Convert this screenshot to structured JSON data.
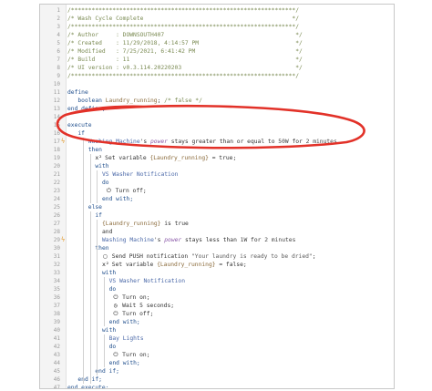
{
  "accent": {
    "annotation": "#e23128",
    "keyword": "#1f4e8c",
    "comment": "#7a8a52"
  },
  "lines": [
    {
      "n": "1",
      "t": [
        {
          "c": "cm",
          "v": "/*****************************************************************/"
        }
      ]
    },
    {
      "n": "2",
      "t": [
        {
          "c": "cm",
          "v": "/* Wash Cycle Complete                                           */"
        }
      ]
    },
    {
      "n": "3",
      "t": [
        {
          "c": "cm",
          "v": "/*****************************************************************/"
        }
      ]
    },
    {
      "n": "4",
      "t": [
        {
          "c": "cm",
          "v": "/* Author     : DOWNSOUTH407                                      */"
        }
      ]
    },
    {
      "n": "5",
      "t": [
        {
          "c": "cm",
          "v": "/* Created    : 11/29/2018, 4:14:57 PM                            */"
        }
      ]
    },
    {
      "n": "6",
      "t": [
        {
          "c": "cm",
          "v": "/* Modified   : 7/25/2021, 6:41:42 PM                             */"
        }
      ]
    },
    {
      "n": "7",
      "t": [
        {
          "c": "cm",
          "v": "/* Build      : 11                                                */"
        }
      ]
    },
    {
      "n": "8",
      "t": [
        {
          "c": "cm",
          "v": "/* UI version : v0.3.114.20220203                                 */"
        }
      ]
    },
    {
      "n": "9",
      "t": [
        {
          "c": "cm",
          "v": "/*****************************************************************/"
        }
      ]
    },
    {
      "n": "10",
      "t": []
    },
    {
      "n": "11",
      "t": [
        {
          "c": "kw",
          "v": "define"
        }
      ]
    },
    {
      "n": "12",
      "t": [
        {
          "c": "kw",
          "v": "   boolean "
        },
        {
          "c": "var",
          "v": "Laundry_running"
        },
        {
          "c": "plain",
          "v": "; "
        },
        {
          "c": "cm",
          "v": "/* false */"
        }
      ]
    },
    {
      "n": "13",
      "t": [
        {
          "c": "kw",
          "v": "end define;"
        }
      ]
    },
    {
      "n": "14",
      "t": []
    },
    {
      "n": "15",
      "t": [
        {
          "c": "kw",
          "v": "execute"
        }
      ]
    },
    {
      "n": "16",
      "t": [
        {
          "c": "kw",
          "v": "   if"
        }
      ]
    },
    {
      "n": "17",
      "warn": true,
      "t": [
        {
          "c": "dev",
          "v": "      Washing Machine"
        },
        {
          "c": "plain",
          "v": "'s "
        },
        {
          "c": "attr",
          "v": "power"
        },
        {
          "c": "plain",
          "v": " stays greater than or equal to "
        },
        {
          "c": "num",
          "v": "50W"
        },
        {
          "c": "plain",
          "v": " for "
        },
        {
          "c": "num",
          "v": "2 minutes"
        }
      ]
    },
    {
      "n": "18",
      "t": [
        {
          "c": "kw",
          "v": "      then"
        }
      ]
    },
    {
      "n": "19",
      "t": [
        {
          "c": "ico",
          "v": "x²"
        },
        {
          "c": "plain",
          "v": " Set variable "
        },
        {
          "c": "var",
          "v": "{Laundry_running}"
        },
        {
          "c": "plain",
          "v": " = true;"
        }
      ],
      "indent": 8
    },
    {
      "n": "20",
      "t": [
        {
          "c": "kw",
          "v": "with"
        }
      ],
      "indent": 8
    },
    {
      "n": "21",
      "t": [
        {
          "c": "dev",
          "v": "VS Washer Notification"
        }
      ],
      "indent": 10
    },
    {
      "n": "22",
      "t": [
        {
          "c": "kw",
          "v": "do"
        }
      ],
      "indent": 10
    },
    {
      "n": "23",
      "t": [
        {
          "c": "ico",
          "v": "⏻"
        },
        {
          "c": "plain",
          "v": " Turn off;"
        }
      ],
      "indent": 11
    },
    {
      "n": "24",
      "t": [
        {
          "c": "kw",
          "v": "end with;"
        }
      ],
      "indent": 10
    },
    {
      "n": "25",
      "t": [
        {
          "c": "kw",
          "v": "else"
        }
      ],
      "indent": 6
    },
    {
      "n": "26",
      "t": [
        {
          "c": "kw",
          "v": "if"
        }
      ],
      "indent": 8
    },
    {
      "n": "27",
      "t": [
        {
          "c": "var",
          "v": "{Laundry_running}"
        },
        {
          "c": "plain",
          "v": " is true"
        }
      ],
      "indent": 10
    },
    {
      "n": "28",
      "t": [
        {
          "c": "plain",
          "v": "and"
        }
      ],
      "indent": 10
    },
    {
      "n": "29",
      "warn": true,
      "t": [
        {
          "c": "dev",
          "v": "Washing Machine"
        },
        {
          "c": "plain",
          "v": "'s "
        },
        {
          "c": "attr",
          "v": "power"
        },
        {
          "c": "plain",
          "v": " stays less than "
        },
        {
          "c": "num",
          "v": "1W"
        },
        {
          "c": "plain",
          "v": " for "
        },
        {
          "c": "num",
          "v": "2 minutes"
        }
      ],
      "indent": 10
    },
    {
      "n": "30",
      "t": [
        {
          "c": "kw",
          "v": "then"
        }
      ],
      "indent": 8
    },
    {
      "n": "31",
      "t": [
        {
          "c": "ico",
          "v": "▢"
        },
        {
          "c": "plain",
          "v": " Send PUSH notification "
        },
        {
          "c": "str",
          "v": "\"Your laundry is ready to be dried\""
        },
        {
          "c": "plain",
          "v": ";"
        }
      ],
      "indent": 10
    },
    {
      "n": "32",
      "t": [
        {
          "c": "ico",
          "v": "x²"
        },
        {
          "c": "plain",
          "v": " Set variable "
        },
        {
          "c": "var",
          "v": "{Laundry_running}"
        },
        {
          "c": "plain",
          "v": " = false;"
        }
      ],
      "indent": 10
    },
    {
      "n": "33",
      "t": [
        {
          "c": "kw",
          "v": "with"
        }
      ],
      "indent": 10
    },
    {
      "n": "34",
      "t": [
        {
          "c": "dev",
          "v": "VS Washer Notification"
        }
      ],
      "indent": 12
    },
    {
      "n": "35",
      "t": [
        {
          "c": "kw",
          "v": "do"
        }
      ],
      "indent": 12
    },
    {
      "n": "36",
      "t": [
        {
          "c": "ico",
          "v": "⏻"
        },
        {
          "c": "plain",
          "v": " Turn on;"
        }
      ],
      "indent": 13
    },
    {
      "n": "37",
      "t": [
        {
          "c": "ico",
          "v": "◷"
        },
        {
          "c": "plain",
          "v": " Wait 5 seconds;"
        }
      ],
      "indent": 13
    },
    {
      "n": "38",
      "t": [
        {
          "c": "ico",
          "v": "⏻"
        },
        {
          "c": "plain",
          "v": " Turn off;"
        }
      ],
      "indent": 13
    },
    {
      "n": "39",
      "t": [
        {
          "c": "kw",
          "v": "end with;"
        }
      ],
      "indent": 12
    },
    {
      "n": "40",
      "t": [
        {
          "c": "kw",
          "v": "with"
        }
      ],
      "indent": 10
    },
    {
      "n": "41",
      "t": [
        {
          "c": "dev",
          "v": "Bay Lights"
        }
      ],
      "indent": 12
    },
    {
      "n": "42",
      "t": [
        {
          "c": "kw",
          "v": "do"
        }
      ],
      "indent": 12
    },
    {
      "n": "43",
      "t": [
        {
          "c": "ico",
          "v": "⏻"
        },
        {
          "c": "plain",
          "v": " Turn on;"
        }
      ],
      "indent": 13
    },
    {
      "n": "44",
      "t": [
        {
          "c": "kw",
          "v": "end with;"
        }
      ],
      "indent": 12
    },
    {
      "n": "45",
      "t": [
        {
          "c": "kw",
          "v": "end if;"
        }
      ],
      "indent": 8
    },
    {
      "n": "46",
      "t": [
        {
          "c": "kw",
          "v": "end if;"
        }
      ],
      "indent": 3
    },
    {
      "n": "47",
      "t": [
        {
          "c": "kw",
          "v": "end execute;"
        }
      ],
      "indent": 0
    }
  ]
}
